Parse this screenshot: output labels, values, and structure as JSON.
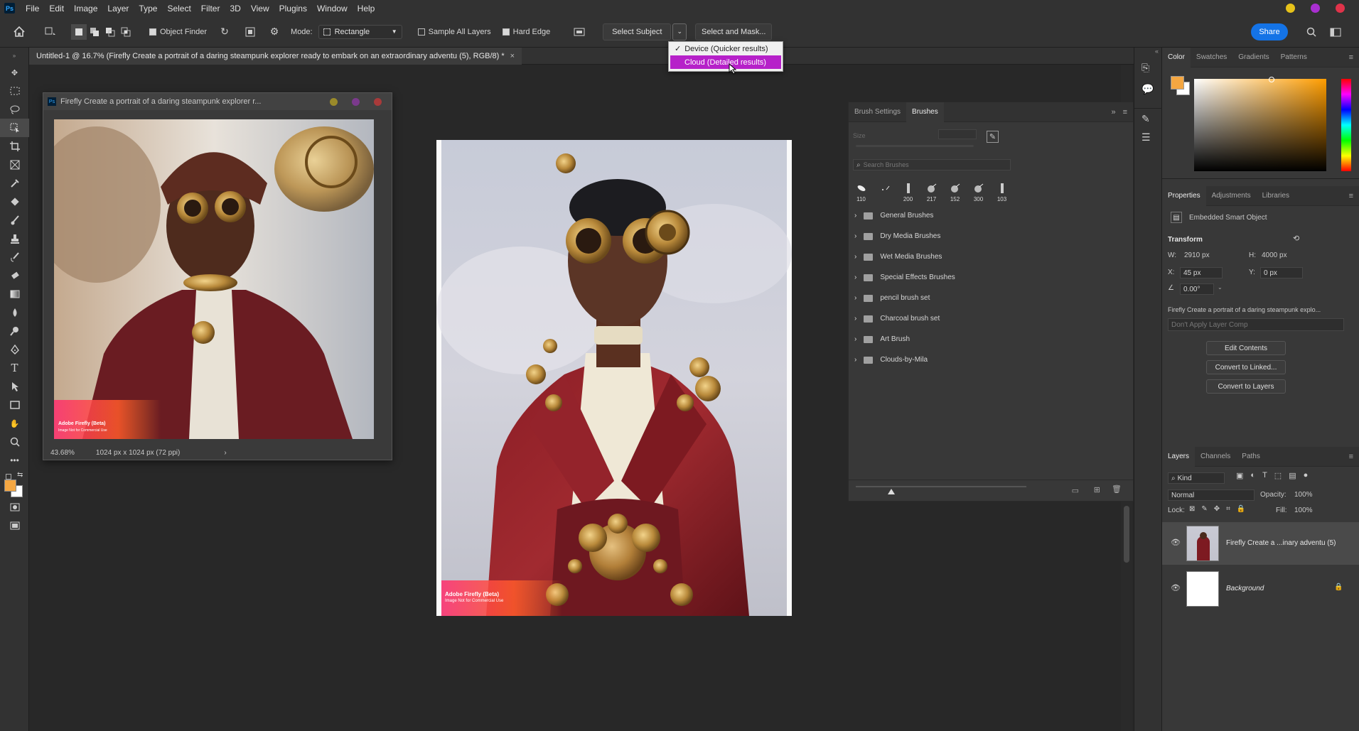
{
  "menu": [
    "File",
    "Edit",
    "Image",
    "Layer",
    "Type",
    "Select",
    "Filter",
    "3D",
    "View",
    "Plugins",
    "Window",
    "Help"
  ],
  "app_logo": "Ps",
  "options": {
    "object_finder": "Object Finder",
    "mode_label": "Mode:",
    "mode_value": "Rectangle",
    "sample_all_layers": "Sample All Layers",
    "hard_edge": "Hard Edge",
    "select_subject": "Select Subject",
    "select_and_mask": "Select and Mask...",
    "share": "Share"
  },
  "dropdown": {
    "device": "Device (Quicker results)",
    "cloud": "Cloud (Detailed results)",
    "device_check": "✓"
  },
  "doc_tab": "Untitled-1 @ 16.7% (Firefly Create a portrait of a daring steampunk explorer ready to embark on an extraordinary adventu (5), RGB/8) *",
  "doc_tab_close": "×",
  "float_window": {
    "title": "Firefly Create a portrait of a daring steampunk explorer r...",
    "zoom": "43.68%",
    "size": "1024 px x 1024 px (72 ppi)",
    "watermark_title": "Adobe Firefly (Beta)",
    "watermark_sub": "Image Not for Commercial Use"
  },
  "canvas_watermark": {
    "title": "Adobe Firefly (Beta)",
    "sub": "Image Not for Commercial Use"
  },
  "brush_panel": {
    "tabs": [
      "Brush Settings",
      "Brushes"
    ],
    "size_label": "Size",
    "search_placeholder": "Search Brushes",
    "presets": [
      "110",
      "",
      "200",
      "217",
      "152",
      "300",
      "103"
    ],
    "folders": [
      "General Brushes",
      "Dry Media Brushes",
      "Wet Media Brushes",
      "Special Effects Brushes",
      "pencil brush set",
      "Charcoal brush set",
      "Art Brush",
      "Clouds-by-Mila"
    ]
  },
  "color_panel": {
    "tabs": [
      "Color",
      "Swatches",
      "Gradients",
      "Patterns"
    ],
    "fg_color": "#f5a742",
    "bg_color": "#ffffff",
    "hue_color": "#ff9d00"
  },
  "properties": {
    "tabs": [
      "Properties",
      "Adjustments",
      "Libraries"
    ],
    "type": "Embedded Smart Object",
    "transform_label": "Transform",
    "w_label": "W:",
    "w": "2910 px",
    "h_label": "H:",
    "h": "4000 px",
    "x_label": "X:",
    "x": "45 px",
    "y_label": "Y:",
    "y": "0 px",
    "angle": "0.00°",
    "source": "Firefly Create a portrait of a daring steampunk explo...",
    "layer_comp": "Don't Apply Layer Comp",
    "buttons": [
      "Edit Contents",
      "Convert to Linked...",
      "Convert to Layers"
    ]
  },
  "layers": {
    "tabs": [
      "Layers",
      "Channels",
      "Paths"
    ],
    "filter": "Kind",
    "blend": "Normal",
    "opacity_label": "Opacity:",
    "opacity": "100%",
    "lock_label": "Lock:",
    "fill_label": "Fill:",
    "fill": "100%",
    "items": [
      {
        "name": "Firefly Create a ...inary adventu (5)"
      },
      {
        "name": "Background"
      }
    ]
  },
  "win_dot_colors": [
    "#e6c21a",
    "#a92fd0",
    "#e0334a"
  ]
}
